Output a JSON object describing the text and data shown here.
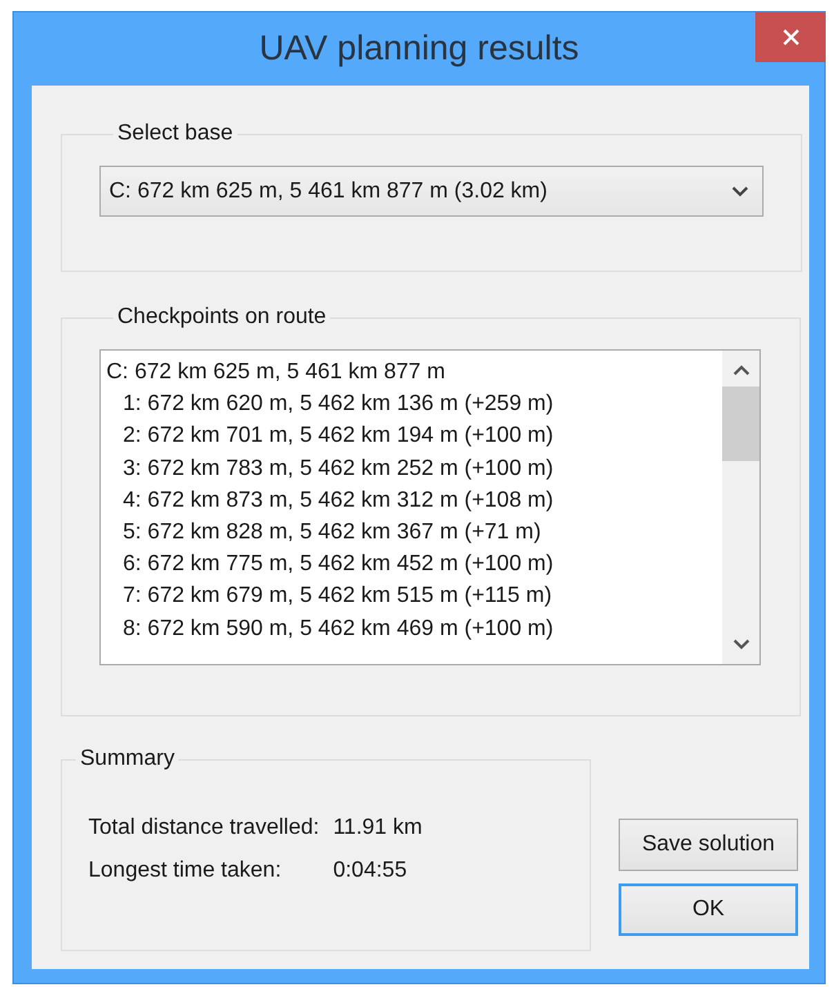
{
  "window": {
    "title": "UAV planning results"
  },
  "select_base": {
    "label": "Select base",
    "value": "C: 672 km 625 m, 5 461 km 877 m (3.02 km)"
  },
  "checkpoints": {
    "label": "Checkpoints on route",
    "items": [
      {
        "kind": "base",
        "text": "C: 672 km 625 m, 5 461 km 877 m"
      },
      {
        "kind": "checkpoint",
        "text": "1: 672 km 620 m, 5 462 km 136 m (+259 m)"
      },
      {
        "kind": "checkpoint",
        "text": "2: 672 km 701 m, 5 462 km 194 m (+100 m)"
      },
      {
        "kind": "checkpoint",
        "text": "3: 672 km 783 m, 5 462 km 252 m (+100 m)"
      },
      {
        "kind": "checkpoint",
        "text": "4: 672 km 873 m, 5 462 km 312 m (+108 m)"
      },
      {
        "kind": "checkpoint",
        "text": "5: 672 km 828 m, 5 462 km 367 m (+71 m)"
      },
      {
        "kind": "checkpoint",
        "text": "6: 672 km 775 m, 5 462 km 452 m (+100 m)"
      },
      {
        "kind": "checkpoint",
        "text": "7: 672 km 679 m, 5 462 km 515 m (+115 m)"
      },
      {
        "kind": "checkpoint",
        "text": "8: 672 km 590 m, 5 462 km 469 m (+100 m)"
      }
    ]
  },
  "summary": {
    "label": "Summary",
    "rows": [
      {
        "label": "Total distance travelled:",
        "value": "11.91 km"
      },
      {
        "label": "Longest time taken:",
        "value": "0:04:55"
      }
    ]
  },
  "buttons": [
    {
      "label": "Save solution",
      "default": false
    },
    {
      "label": "OK",
      "default": true
    }
  ]
}
